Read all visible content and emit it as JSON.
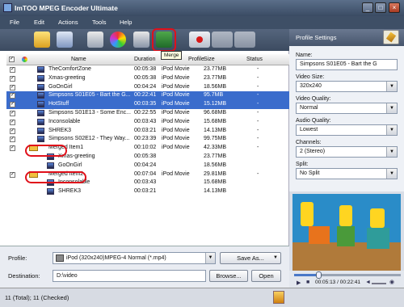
{
  "window": {
    "title": "ImTOO MPEG Encoder Ultimate"
  },
  "menu": [
    "File",
    "Edit",
    "Actions",
    "Tools",
    "Help"
  ],
  "toolbar": {
    "tooltip": "Merge"
  },
  "columns": {
    "name": "Name",
    "duration": "Duration",
    "profile": "Profile",
    "size": "Size",
    "status": "Status"
  },
  "rows": [
    {
      "name": "TheComfortZone",
      "duration": "00:05:38",
      "profile": "iPod Movie",
      "size": "23.77MB",
      "status": "-",
      "checked": true,
      "selected": false,
      "kind": "file",
      "indent": false
    },
    {
      "name": "Xmas-greeting",
      "duration": "00:05:38",
      "profile": "iPod Movie",
      "size": "23.77MB",
      "status": "-",
      "checked": true,
      "selected": false,
      "kind": "file",
      "indent": false
    },
    {
      "name": "GoOnGirl",
      "duration": "00:04:24",
      "profile": "iPod Movie",
      "size": "18.56MB",
      "status": "-",
      "checked": true,
      "selected": false,
      "kind": "file",
      "indent": false
    },
    {
      "name": "Simpsons S01E05 - Bart the G...",
      "duration": "00:22:41",
      "profile": "iPod Movie",
      "size": "95.7MB",
      "status": "-",
      "checked": true,
      "selected": true,
      "kind": "file",
      "indent": false
    },
    {
      "name": "HotStuff",
      "duration": "00:03:35",
      "profile": "iPod Movie",
      "size": "15.12MB",
      "status": "-",
      "checked": true,
      "selected": true,
      "kind": "file",
      "indent": false
    },
    {
      "name": "Simpsons S01E13 - Some Enc...",
      "duration": "00:22:55",
      "profile": "iPod Movie",
      "size": "96.68MB",
      "status": "-",
      "checked": true,
      "selected": false,
      "kind": "file",
      "indent": false
    },
    {
      "name": "Inconsolable",
      "duration": "00:03:43",
      "profile": "iPod Movie",
      "size": "15.68MB",
      "status": "-",
      "checked": true,
      "selected": false,
      "kind": "file",
      "indent": false
    },
    {
      "name": "SHREK3",
      "duration": "00:03:21",
      "profile": "iPod Movie",
      "size": "14.13MB",
      "status": "-",
      "checked": true,
      "selected": false,
      "kind": "file",
      "indent": false
    },
    {
      "name": "Simpsons S02E12 - They Way...",
      "duration": "00:23:39",
      "profile": "iPod Movie",
      "size": "99.75MB",
      "status": "-",
      "checked": true,
      "selected": false,
      "kind": "file",
      "indent": false
    },
    {
      "name": "Merged Item1",
      "duration": "00:10:02",
      "profile": "iPod Movie",
      "size": "42.33MB",
      "status": "-",
      "checked": true,
      "selected": false,
      "kind": "folder",
      "indent": false
    },
    {
      "name": "Xmas-greeting",
      "duration": "00:05:38",
      "profile": "",
      "size": "23.77MB",
      "status": "",
      "checked": false,
      "selected": false,
      "kind": "file",
      "indent": true
    },
    {
      "name": "GoOnGirl",
      "duration": "00:04:24",
      "profile": "",
      "size": "18.56MB",
      "status": "",
      "checked": false,
      "selected": false,
      "kind": "file",
      "indent": true
    },
    {
      "name": "Merged Item2",
      "duration": "00:07:04",
      "profile": "iPod Movie",
      "size": "29.81MB",
      "status": "-",
      "checked": true,
      "selected": false,
      "kind": "folder",
      "indent": false
    },
    {
      "name": "Inconsolable",
      "duration": "00:03:43",
      "profile": "",
      "size": "15.68MB",
      "status": "",
      "checked": false,
      "selected": false,
      "kind": "file",
      "indent": true
    },
    {
      "name": "SHREK3",
      "duration": "00:03:21",
      "profile": "",
      "size": "14.13MB",
      "status": "",
      "checked": false,
      "selected": false,
      "kind": "file",
      "indent": true
    }
  ],
  "bottom": {
    "profile_label": "Profile:",
    "profile_value": "iPod (320x240)MPEG-4 Normal (*.mp4)",
    "save_as": "Save As...",
    "destination_label": "Destination:",
    "destination_value": "D:\\video",
    "browse": "Browse...",
    "open": "Open"
  },
  "status": "11 (Total); 11 (Checked)",
  "settings": {
    "header": "Profile Settings",
    "name_label": "Name:",
    "name_value": "Simpsons S01E05 - Bart the G",
    "video_size_label": "Video Size:",
    "video_size": "320x240",
    "video_quality_label": "Video Quality:",
    "video_quality": "Normal",
    "audio_quality_label": "Audio Quality:",
    "audio_quality": "Lowest",
    "channels_label": "Channels:",
    "channels": "2 (Stereo)",
    "split_label": "Split:",
    "split": "No Split"
  },
  "player": {
    "time": "00:05:13 / 00:22:41",
    "progress": 0.23
  },
  "colors": {
    "selection": "#3a6ccc",
    "highlight": "#e0101a",
    "chrome": "#3e4f66"
  }
}
